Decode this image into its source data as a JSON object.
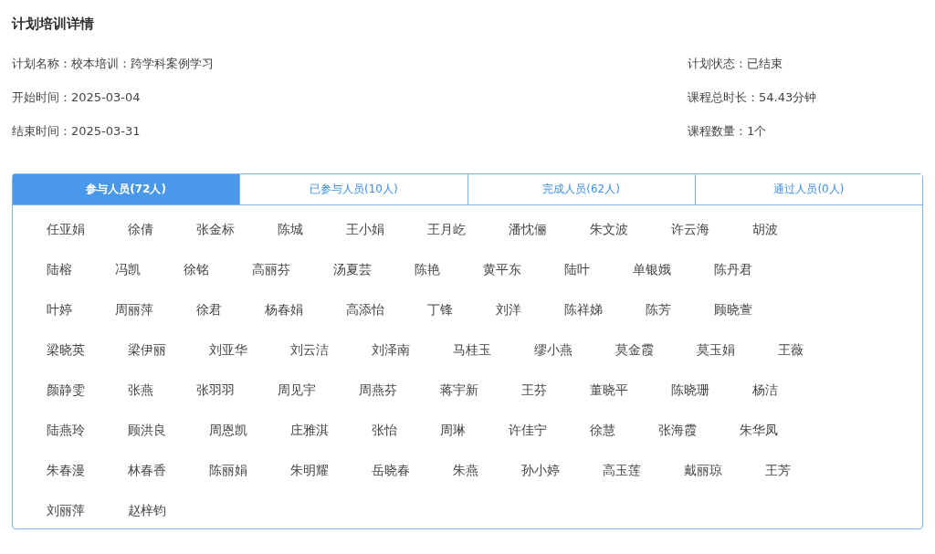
{
  "title": "计划培训详情",
  "info_left": [
    {
      "label": "计划名称：",
      "value": "校本培训：跨学科案例学习"
    },
    {
      "label": "开始时间：",
      "value": "2025-03-04"
    },
    {
      "label": "结束时间：",
      "value": "2025-03-31"
    }
  ],
  "info_right": [
    {
      "label": "计划状态：",
      "value": "已结束"
    },
    {
      "label": "课程总时长：",
      "value": "54.43分钟"
    },
    {
      "label": "课程数量：",
      "value": "1个"
    }
  ],
  "tabs": [
    {
      "label": "参与人员(72人)",
      "selected": true
    },
    {
      "label": "已参与人员(10人)",
      "selected": false
    },
    {
      "label": "完成人员(62人)",
      "selected": false
    },
    {
      "label": "通过人员(0人)",
      "selected": false
    }
  ],
  "people": [
    "任亚娟",
    "徐倩",
    "张金标",
    "陈城",
    "王小娟",
    "王月屹",
    "潘忱俪",
    "朱文波",
    "许云海",
    "胡波",
    "陆榕",
    "冯凯",
    "徐铭",
    "高丽芬",
    "汤夏芸",
    "陈艳",
    "黄平东",
    "陆叶",
    "单银娥",
    "陈丹君",
    "叶婷",
    "周丽萍",
    "徐君",
    "杨春娟",
    "高添怡",
    "丁锋",
    "刘洋",
    "陈祥娣",
    "陈芳",
    "顾晓萱",
    "梁晓英",
    "梁伊丽",
    "刘亚华",
    "刘云洁",
    "刘泽南",
    "马桂玉",
    "缪小燕",
    "莫金霞",
    "莫玉娟",
    "王薇",
    "颜静雯",
    "张燕",
    "张羽羽",
    "周见宇",
    "周燕芬",
    "蒋宇新",
    "王芬",
    "董晓平",
    "陈晓珊",
    "杨洁",
    "陆燕玲",
    "顾洪良",
    "周恩凯",
    "庄雅淇",
    "张怡",
    "周琳",
    "许佳宁",
    "徐慧",
    "张海霞",
    "朱华凤",
    "朱春漫",
    "林春香",
    "陈丽娟",
    "朱明耀",
    "岳晓春",
    "朱燕",
    "孙小婷",
    "高玉莲",
    "戴丽琼",
    "王芳",
    "刘丽萍",
    "赵梓钧"
  ]
}
